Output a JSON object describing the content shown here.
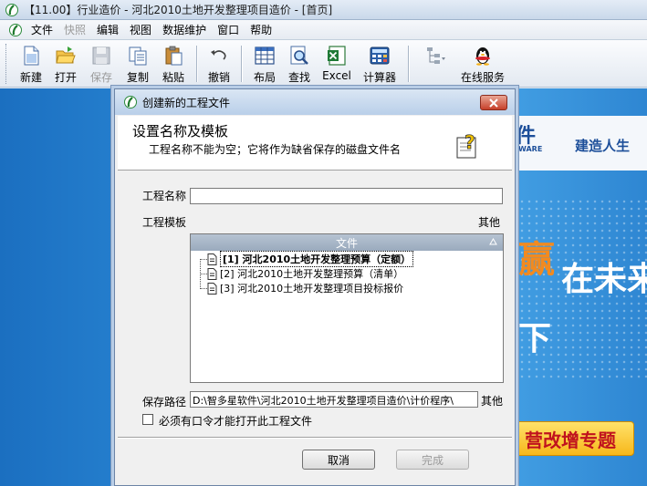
{
  "window": {
    "title": "【11.00】行业造价 - 河北2010土地开发整理项目造价 - [首页]"
  },
  "menu": [
    {
      "label": "文件",
      "enabled": true
    },
    {
      "label": "快照",
      "enabled": false
    },
    {
      "label": "编辑",
      "enabled": true
    },
    {
      "label": "视图",
      "enabled": true
    },
    {
      "label": "数据维护",
      "enabled": true
    },
    {
      "label": "窗口",
      "enabled": true
    },
    {
      "label": "帮助",
      "enabled": true
    }
  ],
  "toolbar": {
    "new": "新建",
    "open": "打开",
    "save": "保存",
    "copy": "复制",
    "paste": "粘贴",
    "undo": "撤销",
    "layout": "布局",
    "find": "查找",
    "excel": "Excel",
    "calculator": "计算器",
    "online": "在线服务"
  },
  "banner": {
    "logo": "件",
    "logo_sub": "WARE",
    "slogan": "建造人生",
    "big1": "赢",
    "big2": "在未来",
    "big3": "下",
    "promo": "营改增专题"
  },
  "dialog": {
    "title": "创建新的工程文件",
    "header_title": "设置名称及模板",
    "header_sub": "工程名称不能为空；它将作为缺省保存的磁盘文件名",
    "name_label": "工程名称",
    "name_value": "",
    "template_label": "工程模板",
    "template_other": "其他",
    "tree_header": "文件",
    "templates": [
      "[1] 河北2010土地开发整理预算（定额）",
      "[2] 河北2010土地开发整理预算（清单）",
      "[3] 河北2010土地开发整理项目投标报价"
    ],
    "selected_template": 0,
    "path_label": "保存路径",
    "path_value": "D:\\智多星软件\\河北2010土地开发整理项目造价\\计价程序\\",
    "path_other": "其他",
    "password_label": "必须有口令才能打开此工程文件",
    "password_checked": false,
    "cancel": "取消",
    "finish": "完成"
  },
  "colors": {
    "accent": "#1b6fc0",
    "promo_text": "#c0121e",
    "promo_bg": "#f7b81b"
  }
}
